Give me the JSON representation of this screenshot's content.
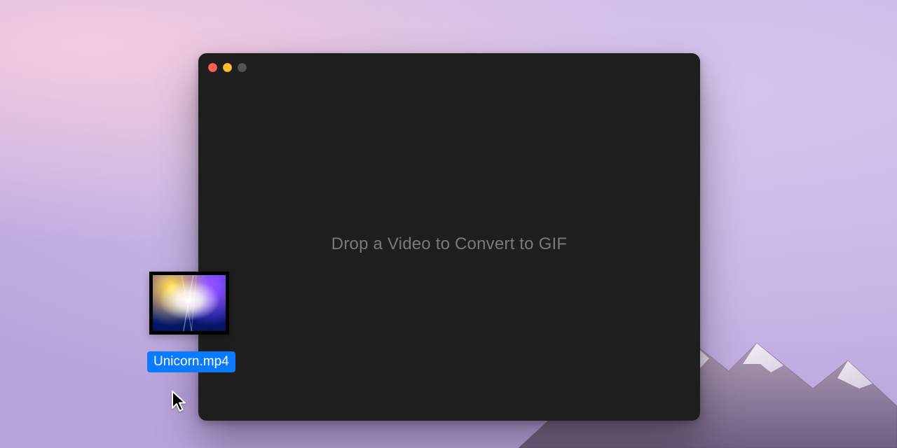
{
  "window": {
    "dropzone_text": "Drop a Video to Convert to GIF"
  },
  "dragged_file": {
    "name": "Unicorn.mp4"
  },
  "colors": {
    "window_bg": "#1e1e1e",
    "drop_text": "#7a7a7a",
    "selection_bg": "#0a7bff",
    "selection_fg": "#ffffff",
    "traffic_close": "#ff5f57",
    "traffic_min": "#febc2e",
    "traffic_zoom_disabled": "#535353"
  }
}
